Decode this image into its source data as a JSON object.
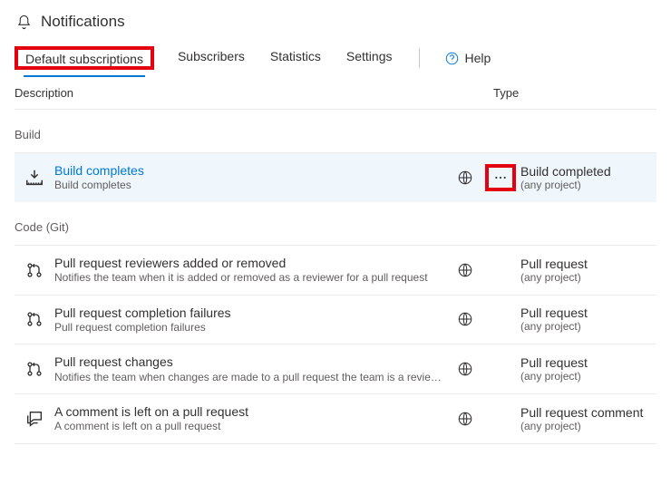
{
  "header": {
    "title": "Notifications"
  },
  "tabs": {
    "items": [
      {
        "label": "Default subscriptions"
      },
      {
        "label": "Subscribers"
      },
      {
        "label": "Statistics"
      },
      {
        "label": "Settings"
      }
    ],
    "help": "Help"
  },
  "columns": {
    "description": "Description",
    "type": "Type"
  },
  "sections": {
    "build": {
      "title": "Build",
      "rows": [
        {
          "title": "Build completes",
          "sub": "Build completes",
          "type_title": "Build completed",
          "type_sub": "(any project)"
        }
      ]
    },
    "code": {
      "title": "Code (Git)",
      "rows": [
        {
          "title": "Pull request reviewers added or removed",
          "sub": "Notifies the team when it is added or removed as a reviewer for a pull request",
          "type_title": "Pull request",
          "type_sub": "(any project)"
        },
        {
          "title": "Pull request completion failures",
          "sub": "Pull request completion failures",
          "type_title": "Pull request",
          "type_sub": "(any project)"
        },
        {
          "title": "Pull request changes",
          "sub": "Notifies the team when changes are made to a pull request the team is a reviewer for",
          "type_title": "Pull request",
          "type_sub": "(any project)"
        },
        {
          "title": "A comment is left on a pull request",
          "sub": "A comment is left on a pull request",
          "type_title": "Pull request comment",
          "type_sub": "(any project)"
        }
      ]
    }
  }
}
